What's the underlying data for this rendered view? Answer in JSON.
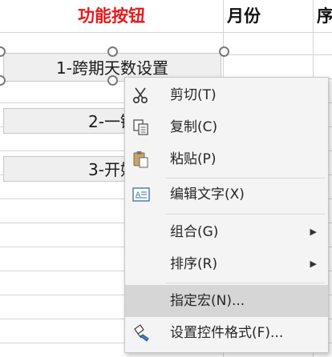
{
  "sheet": {
    "header": {
      "col_buttons": "功能按钮",
      "col_month": "月份",
      "col_seq": "序"
    },
    "buttons": [
      {
        "label": "1-跨期天数设置"
      },
      {
        "label": "2-一键"
      },
      {
        "label": "3-开始"
      }
    ],
    "colors": {
      "header_red": "#e8191a",
      "highlight": "#d6d6d6"
    }
  },
  "context_menu": {
    "items": [
      {
        "label": "剪切(T)",
        "icon": "scissors-icon"
      },
      {
        "label": "复制(C)",
        "icon": "copy-icon"
      },
      {
        "label": "粘贴(P)",
        "icon": "paste-icon"
      },
      {
        "label": "编辑文字(X)",
        "icon": "edit-text-icon"
      },
      {
        "label": "组合(G)",
        "submenu": true
      },
      {
        "label": "排序(R)",
        "submenu": true
      },
      {
        "label": "指定宏(N)...",
        "highlighted": true
      },
      {
        "label": "设置控件格式(F)...",
        "icon": "format-control-icon"
      }
    ]
  }
}
